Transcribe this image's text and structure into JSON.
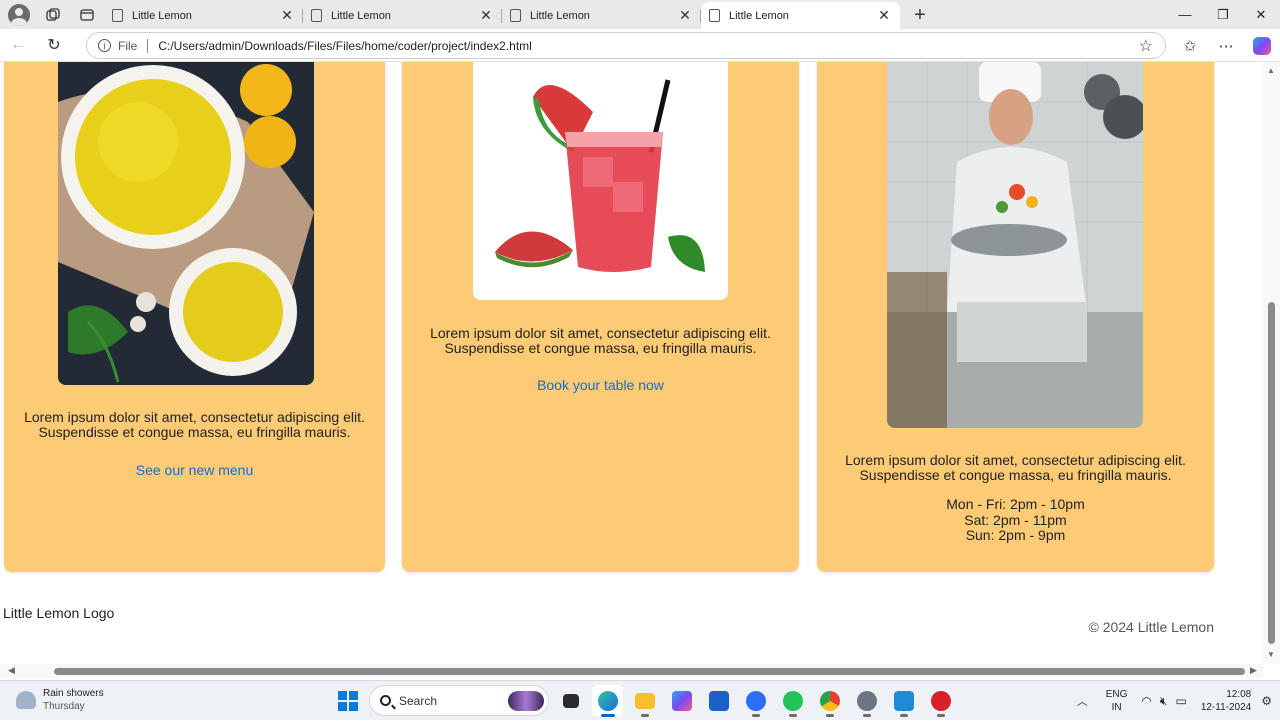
{
  "browser": {
    "tabs": [
      {
        "title": "Little Lemon",
        "active": false
      },
      {
        "title": "Little Lemon",
        "active": false
      },
      {
        "title": "Little Lemon",
        "active": false
      },
      {
        "title": "Little Lemon",
        "active": true
      }
    ],
    "address": {
      "scheme_label": "File",
      "url": "C:/Users/admin/Downloads/Files/Files/home/coder/project/index2.html"
    }
  },
  "page": {
    "cards": [
      {
        "image_alt": "Lemon rice dish",
        "text": "Lorem ipsum dolor sit amet, consectetur adipiscing elit. Suspendisse et congue massa, eu fringilla mauris.",
        "link": "See our new menu"
      },
      {
        "image_alt": "Watermelon drink",
        "text": "Lorem ipsum dolor sit amet, consectetur adipiscing elit. Suspendisse et congue massa, eu fringilla mauris.",
        "link": "Book your table now"
      },
      {
        "image_alt": "Chef cooking",
        "text": "Lorem ipsum dolor sit amet, consectetur adipiscing elit. Suspendisse et congue massa, eu fringilla mauris.",
        "hours": [
          "Mon - Fri: 2pm - 10pm",
          "Sat: 2pm - 11pm",
          "Sun: 2pm - 9pm"
        ]
      }
    ],
    "footer": {
      "logo": "Little Lemon Logo",
      "copyright": "© 2024 Little Lemon"
    },
    "colors": {
      "card_bg": "#fdca76",
      "link": "#1a6bc8"
    }
  },
  "taskbar": {
    "weather": {
      "title": "Rain showers",
      "subtitle": "Thursday"
    },
    "search_placeholder": "Search",
    "language": {
      "line1": "ENG",
      "line2": "IN"
    },
    "clock": {
      "time": "12:08",
      "date": "12-11-2024"
    }
  }
}
